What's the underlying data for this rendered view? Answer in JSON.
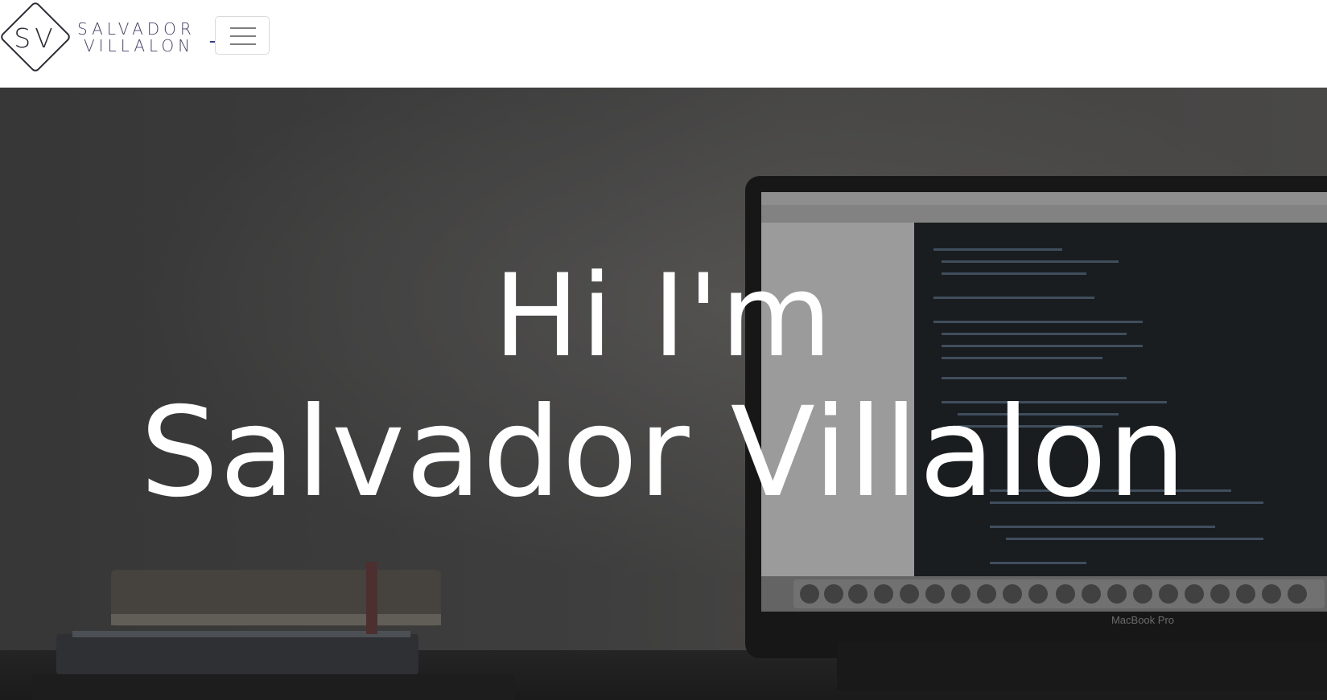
{
  "header": {
    "logo": {
      "monogram": "SV",
      "name_line1": "SALVADOR",
      "name_line2": "VILLALON"
    },
    "menu_toggle_icon": "hamburger-icon"
  },
  "hero": {
    "title_line1": "Hi I'm",
    "title_line2": "Salvador Villalon",
    "background_image": "laptop-desk-photo",
    "laptop_label": "MacBook Pro"
  },
  "colors": {
    "brand_text": "#44416a",
    "hero_text": "#ffffff",
    "nav_background": "#ffffff"
  }
}
